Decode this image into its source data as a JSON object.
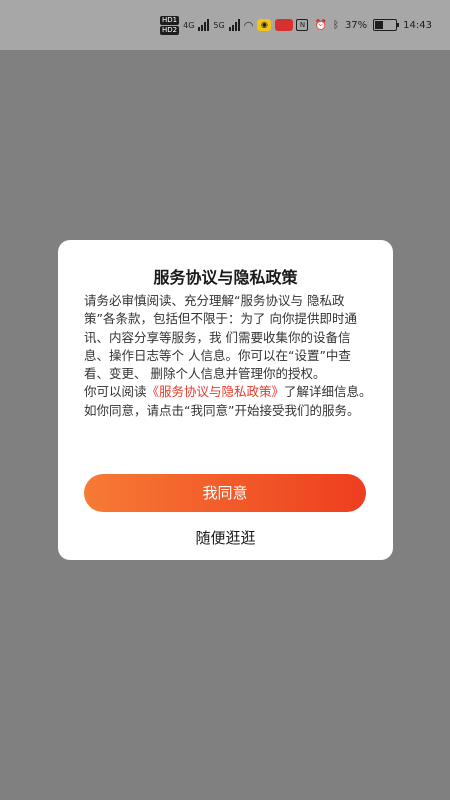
{
  "status_bar": {
    "hd_1": "HD",
    "sim_1": "1",
    "hd_2": "HD",
    "sim_2": "2",
    "net_1": "4G",
    "net_2": "5G",
    "battery_text": "37%",
    "battery_level": 0.37,
    "time": "14:43",
    "icons": [
      "signal-icon",
      "wifi-icon",
      "eye-icon",
      "app-badge-icon",
      "nfc-icon",
      "alarm-icon",
      "bluetooth-icon"
    ]
  },
  "dialog": {
    "title": "服务协议与隐私政策",
    "body_intro": "请务必审慎阅读、充分理解“服务协议与 隐私政策”各条款，包括但不限于：为了 向你提供即时通讯、内容分享等服务，我 们需要收集你的设备信息、操作日志等个 人信息。你可以在“设置”中查看、变更、 删除个人信息并管理你的授权。",
    "body_read_prefix": "你可以阅读",
    "policy_link": "《服务协议与隐私政策》",
    "body_read_suffix": "了解详细信息。如你同意，请点击“我同意”开始接受我们的服务。",
    "agree_label": "我同意",
    "browse_label": "随便逛逛"
  },
  "colors": {
    "overlay": "#808080",
    "accent_start": "#f77a35",
    "accent_end": "#ee3e1f",
    "link": "#e63a2a"
  }
}
